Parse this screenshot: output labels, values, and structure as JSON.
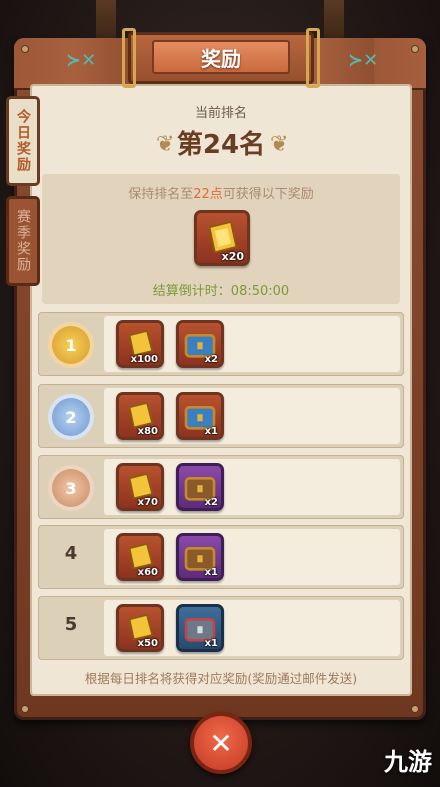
{
  "title": "奖励",
  "tabs": [
    {
      "label": "今日奖励",
      "active": true
    },
    {
      "label": "赛季奖励",
      "active": false
    }
  ],
  "current": {
    "rank_label": "当前排名",
    "rank_value": "第24名",
    "keep_prefix": "保持排名至",
    "keep_time": "22点",
    "keep_suffix": "可获得以下奖励",
    "reward_qty": "x20",
    "countdown": "结算倒计时：08:50:00"
  },
  "tiers": [
    {
      "rank": "1",
      "style": "gold",
      "rewards": [
        {
          "item": "golden-ticket",
          "qty": "x100"
        },
        {
          "item": "blue-chest",
          "qty": "x2"
        }
      ]
    },
    {
      "rank": "2",
      "style": "silver",
      "rewards": [
        {
          "item": "golden-ticket",
          "qty": "x80"
        },
        {
          "item": "blue-chest",
          "qty": "x1"
        }
      ]
    },
    {
      "rank": "3",
      "style": "bronze",
      "rewards": [
        {
          "item": "golden-ticket",
          "qty": "x70"
        },
        {
          "item": "purple-chest",
          "qty": "x2"
        }
      ]
    },
    {
      "rank": "4",
      "style": "plain",
      "rewards": [
        {
          "item": "golden-ticket",
          "qty": "x60"
        },
        {
          "item": "purple-chest",
          "qty": "x1"
        }
      ]
    },
    {
      "rank": "5",
      "style": "plain",
      "rewards": [
        {
          "item": "golden-ticket",
          "qty": "x50"
        },
        {
          "item": "iron-chest",
          "qty": "x1"
        }
      ]
    }
  ],
  "footer_note": "根据每日排名将获得对应奖励(奖励通过邮件发送)",
  "close_symbol": "✕",
  "watermark": "九游",
  "colors": {
    "accent": "#e06a3a",
    "gold": "#e8b23a",
    "silver": "#8fb4e0",
    "bronze": "#d49a74"
  }
}
